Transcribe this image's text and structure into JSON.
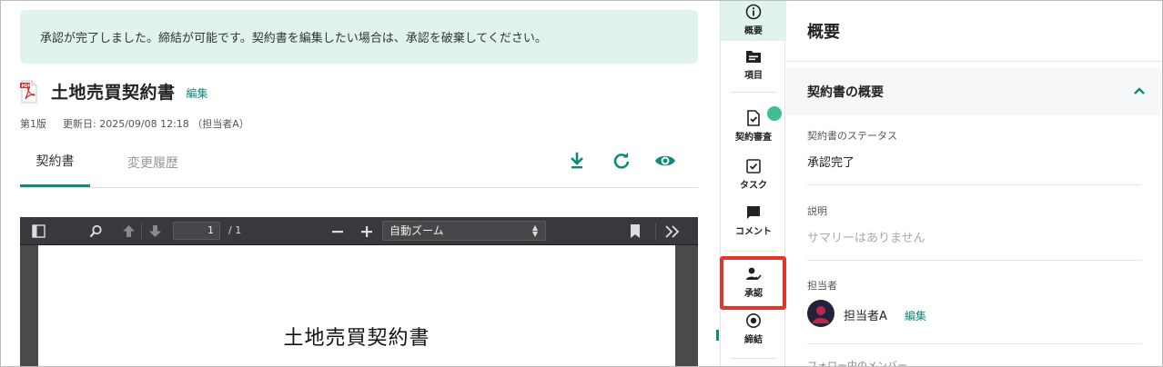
{
  "banner": {
    "message": "承認が完了しました。締結が可能です。契約書を編集したい場合は、承認を破棄してください。"
  },
  "document": {
    "title": "土地売買契約書",
    "edit_label": "編集",
    "version": "第1版",
    "updated": "更新日: 2025/09/08 12:18 （担当者A）"
  },
  "tabs": [
    {
      "label": "契約書"
    },
    {
      "label": "変更履歴"
    }
  ],
  "viewer": {
    "page_current": "1",
    "page_total": "/ 1",
    "zoom": "自動ズーム",
    "page_title": "土地売買契約書"
  },
  "rail": {
    "items": [
      {
        "label": "概要",
        "icon": "info-icon"
      },
      {
        "label": "項目",
        "icon": "folder-icon"
      },
      {
        "label": "契約審査",
        "icon": "document-check-icon"
      },
      {
        "label": "タスク",
        "icon": "checkbox-icon"
      },
      {
        "label": "コメント",
        "icon": "comment-icon"
      },
      {
        "label": "承認",
        "icon": "user-check-icon"
      },
      {
        "label": "締結",
        "icon": "target-icon"
      }
    ]
  },
  "panel": {
    "title": "概要",
    "section_title": "契約書の概要",
    "status_label": "契約書のステータス",
    "status_value": "承認完了",
    "description_label": "説明",
    "description_value": "サマリーはありません",
    "assignee_label": "担当者",
    "assignee_name": "担当者A",
    "assignee_edit": "編集",
    "followers_label": "フォロー中のメンバー"
  },
  "colors": {
    "accent": "#0e8a76",
    "banner_bg": "#e1f3ee",
    "highlight": "#e3362a",
    "status_dot": "#3fbf8f"
  }
}
